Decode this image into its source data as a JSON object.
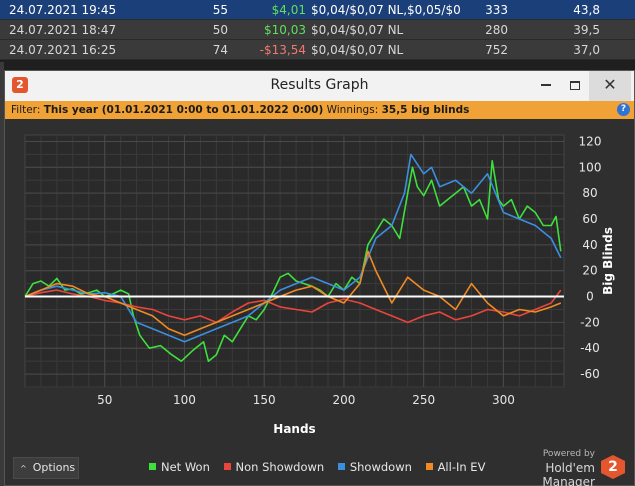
{
  "sessions": [
    {
      "date": "24.07.2021 19:45",
      "hands": "55",
      "won": "$4,01",
      "stakes": "$0,04/$0,07 NL,$0,05/$0",
      "vpip": "333",
      "pfr": "43,8",
      "won_color": "#5fe05f"
    },
    {
      "date": "24.07.2021 18:47",
      "hands": "50",
      "won": "$10,03",
      "stakes": "$0,04/$0,07 NL",
      "vpip": "280",
      "pfr": "39,5",
      "won_color": "#5fe05f"
    },
    {
      "date": "24.07.2021 16:25",
      "hands": "74",
      "won": "-$13,54",
      "stakes": "$0,04/$0,07 NL",
      "vpip": "752",
      "pfr": "37,0",
      "won_color": "#f07a6e"
    }
  ],
  "dialog": {
    "title": "Results Graph",
    "app_icon": "hm2-logo-icon",
    "min_icon": "minimize-icon",
    "max_icon": "maximize-icon",
    "close_icon": "close-icon",
    "close_glyph": "✕"
  },
  "filter": {
    "label": "Filter:",
    "value": "This year (01.01.2021 0:00 to 01.01.2022 0:00)",
    "winnings_label": "Winnings:",
    "winnings_value": "35,5 big blinds",
    "help_glyph": "?"
  },
  "options": {
    "label": "Options",
    "chevron": "^"
  },
  "legend_items": [
    {
      "label": "Net Won",
      "color": "#3ee03e"
    },
    {
      "label": "Non Showdown",
      "color": "#e8453c"
    },
    {
      "label": "Showdown",
      "color": "#3b8fe0"
    },
    {
      "label": "All-In EV",
      "color": "#f08a24"
    }
  ],
  "powered": {
    "line1": "Powered by",
    "line2": "Hold'em Manager",
    "logo_text": "2"
  },
  "chart_data": {
    "type": "line",
    "xlabel": "Hands",
    "ylabel": "Big Blinds",
    "xlim": [
      0,
      338
    ],
    "ylim": [
      -70,
      125
    ],
    "xticks": [
      50,
      100,
      150,
      200,
      250,
      300
    ],
    "yticks": [
      -60,
      -40,
      -20,
      0,
      20,
      40,
      60,
      80,
      100,
      120
    ],
    "grid": true,
    "legend": "bottom",
    "series": [
      {
        "name": "Net Won",
        "color": "#3ee03e",
        "x": [
          0,
          5,
          10,
          15,
          20,
          25,
          30,
          35,
          40,
          45,
          50,
          55,
          60,
          65,
          68,
          72,
          78,
          85,
          92,
          98,
          105,
          112,
          115,
          120,
          125,
          130,
          135,
          140,
          145,
          150,
          155,
          160,
          165,
          170,
          175,
          180,
          185,
          190,
          195,
          200,
          205,
          210,
          215,
          220,
          225,
          230,
          235,
          240,
          243,
          246,
          250,
          255,
          260,
          265,
          270,
          275,
          280,
          285,
          290,
          293,
          297,
          300,
          305,
          310,
          315,
          320,
          325,
          330,
          333,
          336
        ],
        "y": [
          0,
          10,
          12,
          8,
          14,
          5,
          6,
          2,
          3,
          5,
          0,
          2,
          5,
          2,
          -15,
          -30,
          -40,
          -38,
          -45,
          -50,
          -42,
          -35,
          -50,
          -45,
          -30,
          -35,
          -25,
          -15,
          -18,
          -10,
          2,
          15,
          18,
          12,
          10,
          8,
          5,
          0,
          10,
          5,
          15,
          10,
          40,
          50,
          60,
          55,
          45,
          80,
          100,
          85,
          78,
          90,
          70,
          75,
          80,
          85,
          70,
          75,
          60,
          105,
          75,
          70,
          75,
          60,
          70,
          65,
          55,
          55,
          62,
          35
        ]
      },
      {
        "name": "Non Showdown",
        "color": "#e8453c",
        "x": [
          0,
          10,
          20,
          30,
          40,
          50,
          60,
          70,
          80,
          90,
          100,
          110,
          120,
          130,
          140,
          150,
          160,
          170,
          180,
          190,
          200,
          210,
          220,
          230,
          240,
          250,
          260,
          270,
          280,
          290,
          300,
          310,
          320,
          330,
          336
        ],
        "y": [
          0,
          3,
          5,
          2,
          0,
          -3,
          -5,
          -8,
          -10,
          -15,
          -18,
          -15,
          -20,
          -12,
          -5,
          -3,
          -8,
          -10,
          -12,
          -5,
          -2,
          -5,
          -10,
          -15,
          -20,
          -15,
          -12,
          -18,
          -15,
          -10,
          -12,
          -15,
          -10,
          -5,
          5
        ]
      },
      {
        "name": "Showdown",
        "color": "#3b8fe0",
        "x": [
          0,
          10,
          20,
          30,
          40,
          50,
          60,
          70,
          80,
          90,
          100,
          110,
          120,
          130,
          140,
          150,
          160,
          170,
          180,
          190,
          200,
          210,
          220,
          230,
          238,
          242,
          250,
          255,
          260,
          270,
          280,
          290,
          300,
          310,
          320,
          330,
          336
        ],
        "y": [
          0,
          5,
          8,
          5,
          2,
          3,
          0,
          -20,
          -25,
          -30,
          -35,
          -30,
          -25,
          -20,
          -15,
          -5,
          5,
          10,
          15,
          10,
          5,
          15,
          45,
          55,
          80,
          110,
          95,
          100,
          85,
          90,
          80,
          95,
          65,
          60,
          55,
          45,
          30
        ]
      },
      {
        "name": "All-In EV",
        "color": "#f08a24",
        "x": [
          0,
          10,
          20,
          30,
          40,
          50,
          60,
          70,
          80,
          90,
          100,
          110,
          120,
          130,
          140,
          150,
          160,
          170,
          180,
          190,
          200,
          210,
          215,
          220,
          230,
          240,
          250,
          260,
          270,
          280,
          290,
          300,
          310,
          320,
          330,
          336
        ],
        "y": [
          0,
          5,
          10,
          8,
          2,
          0,
          -5,
          -10,
          -15,
          -25,
          -30,
          -25,
          -20,
          -15,
          -10,
          -5,
          0,
          5,
          8,
          0,
          -5,
          10,
          35,
          20,
          -5,
          15,
          5,
          0,
          -10,
          10,
          -5,
          -15,
          -10,
          -12,
          -8,
          -5
        ]
      }
    ]
  }
}
